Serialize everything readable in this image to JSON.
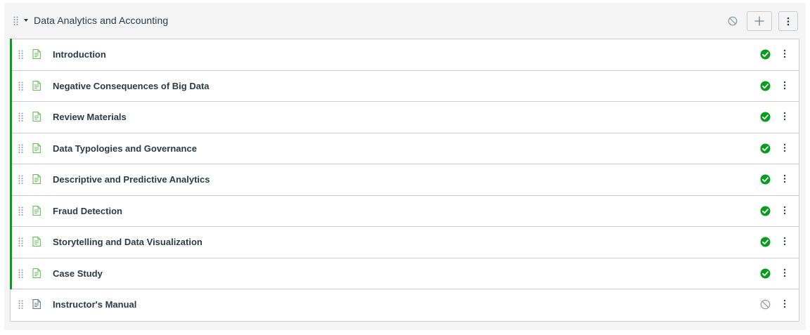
{
  "module": {
    "title": "Data Analytics and Accounting",
    "header_status": "unpublished",
    "icons": {
      "drag": "drag-handle-icon",
      "collapse": "caret-down-icon",
      "status": "unpublished-icon",
      "add": "plus-icon",
      "menu": "kebab-menu-icon"
    }
  },
  "items": [
    {
      "title": "Introduction",
      "type": "page",
      "status": "published"
    },
    {
      "title": "Negative Consequences of Big Data",
      "type": "page",
      "status": "published"
    },
    {
      "title": "Review Materials",
      "type": "page",
      "status": "published"
    },
    {
      "title": "Data Typologies and Governance",
      "type": "page",
      "status": "published"
    },
    {
      "title": "Descriptive and Predictive Analytics",
      "type": "page",
      "status": "published"
    },
    {
      "title": "Fraud Detection",
      "type": "page",
      "status": "published"
    },
    {
      "title": "Storytelling and Data Visualization",
      "type": "page",
      "status": "published"
    },
    {
      "title": "Case Study",
      "type": "page",
      "status": "published"
    },
    {
      "title": "Instructor's Manual",
      "type": "page",
      "status": "unpublished"
    }
  ],
  "colors": {
    "published": "#0b9b1e",
    "published_page_icon": "#6bbf5e",
    "unpublished": "#8b969e",
    "text": "#2d3b45",
    "border": "#c7cdd1",
    "module_bg": "#f5f5f5"
  }
}
